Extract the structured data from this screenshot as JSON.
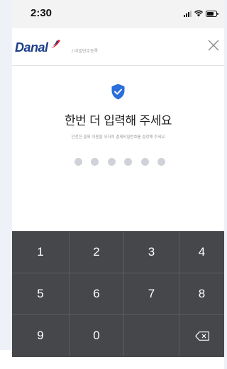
{
  "status_bar": {
    "time": "2:30",
    "icons": [
      "signal-icon",
      "wifi-icon",
      "battery-icon"
    ]
  },
  "header": {
    "logo_text": "Danal",
    "breadcrumb": "/ 비밀번호등록",
    "close_icon": "close-icon"
  },
  "main": {
    "icon": "shield-check-icon",
    "title": "한번 더 입력해 주세요",
    "subtitle": "안전한 결제 이용을 위하여 결제비밀번호를 설정해 주세요",
    "pin_length": 6,
    "pin_entered": 0
  },
  "keypad": {
    "keys": [
      "1",
      "2",
      "3",
      "4",
      "5",
      "6",
      "7",
      "8",
      "9",
      "0",
      "",
      "backspace"
    ],
    "backspace_icon": "backspace-icon"
  },
  "colors": {
    "brand_navy": "#1d3e8a",
    "brand_red": "#e3262c",
    "shield_blue": "#2a6fdb",
    "keypad_bg": "#46474b",
    "dot_empty": "#cfd2d8"
  }
}
